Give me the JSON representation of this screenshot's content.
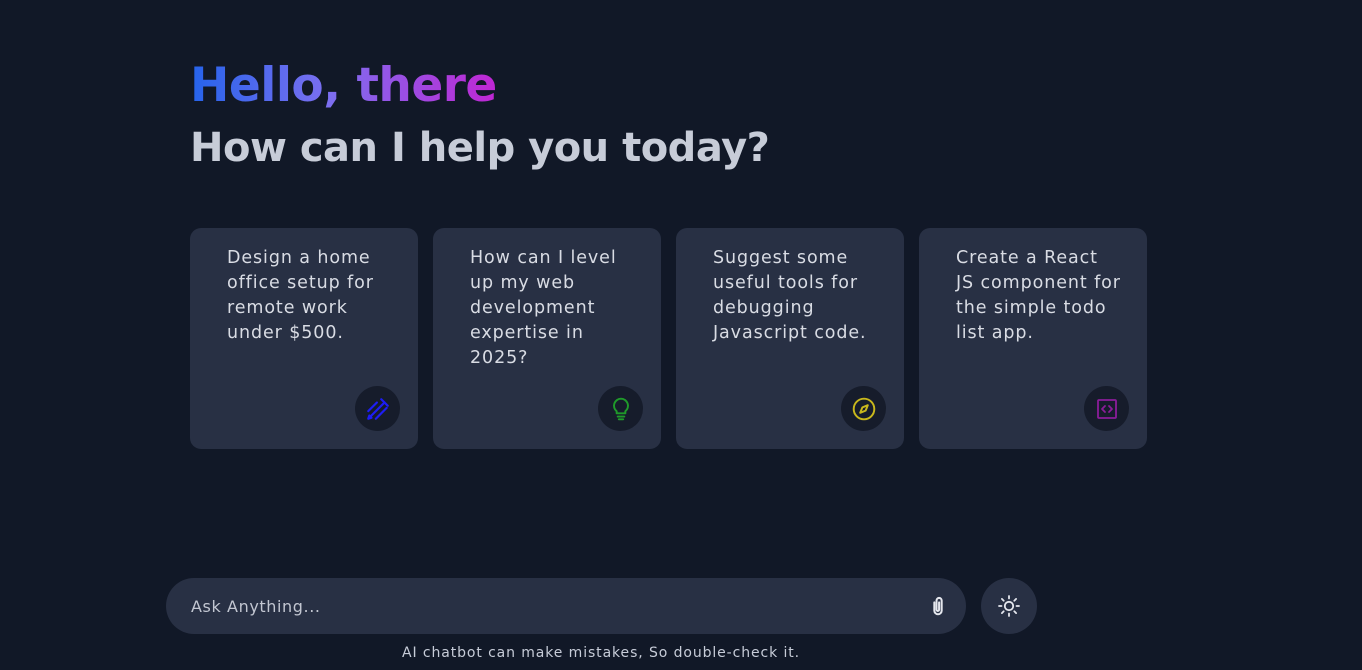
{
  "header": {
    "greeting": "Hello, there",
    "subtitle": "How can I help you today?"
  },
  "suggestions": [
    {
      "text": "Design a home office setup for remote work under $500.",
      "icon": "draw-icon",
      "icon_color": "#1d1df5"
    },
    {
      "text": "How can I level up my web development expertise in 2025?",
      "icon": "lightbulb-icon",
      "icon_color": "#1f9a2a"
    },
    {
      "text": "Suggest some useful tools for debugging Javascript code.",
      "icon": "explore-icon",
      "icon_color": "#c9b81c"
    },
    {
      "text": "Create a React JS component for the simple todo list app.",
      "icon": "code-blocks-icon",
      "icon_color": "#8b1c9a"
    }
  ],
  "prompt": {
    "placeholder": "Ask Anything...",
    "attach_icon": "paperclip-icon",
    "theme_icon": "light-mode-icon"
  },
  "footer": {
    "disclaimer": "AI chatbot can make mistakes, So double-check it."
  },
  "colors": {
    "background": "#111827",
    "card": "#283044",
    "gradient_start": "#2563eb",
    "gradient_end": "#c026d3"
  }
}
